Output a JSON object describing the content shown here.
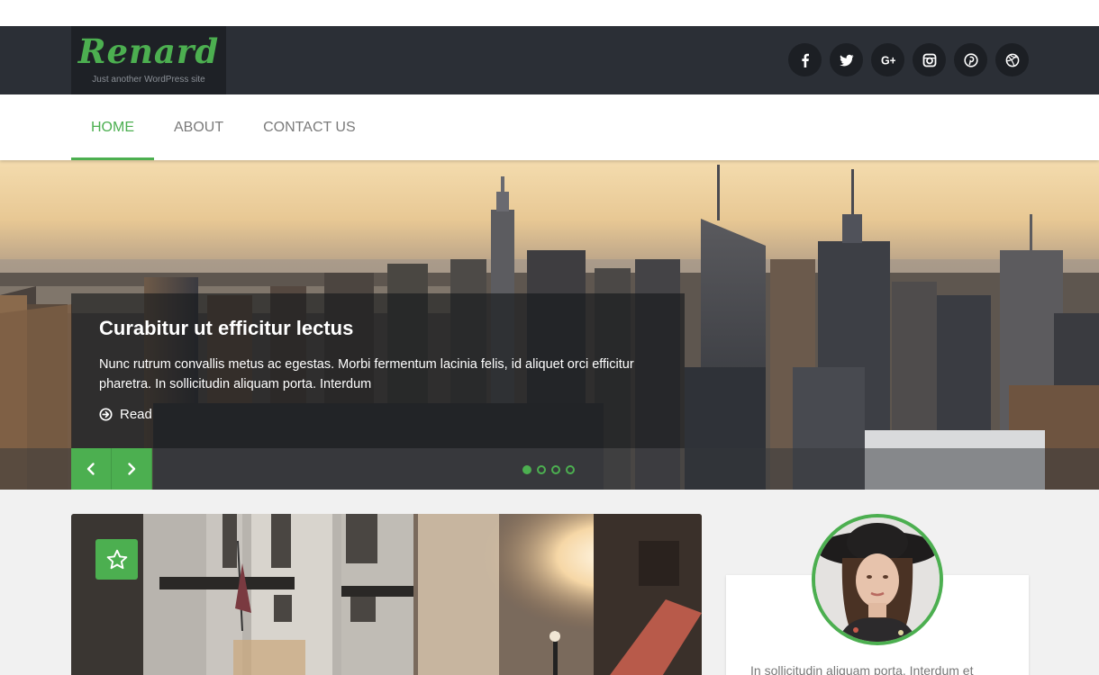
{
  "site": {
    "logo": "Renard",
    "tagline": "Just another WordPress site"
  },
  "social": [
    {
      "icon": "facebook-icon",
      "glyph": "f"
    },
    {
      "icon": "twitter-icon",
      "glyph": ""
    },
    {
      "icon": "google-plus-icon",
      "glyph": "G+"
    },
    {
      "icon": "instagram-icon",
      "glyph": ""
    },
    {
      "icon": "pinterest-icon",
      "glyph": ""
    },
    {
      "icon": "dribbble-icon",
      "glyph": ""
    }
  ],
  "nav": {
    "items": [
      {
        "label": "HOME",
        "active": true
      },
      {
        "label": "ABOUT",
        "active": false
      },
      {
        "label": "CONTACT US",
        "active": false
      }
    ]
  },
  "slider": {
    "title": "Curabitur ut efficitur lectus",
    "text": "Nunc rutrum convallis metus ac egestas. Morbi fermentum lacinia felis, id aliquet orci efficitur pharetra. In sollicitudin aliquam porta. Interdum",
    "read_label": "Read",
    "slide_count": 4,
    "active_slide": 1
  },
  "profile": {
    "text": "In sollicitudin aliquam porta. Interdum et"
  },
  "colors": {
    "accent": "#4caf50",
    "header_bg": "#2b2f36"
  }
}
